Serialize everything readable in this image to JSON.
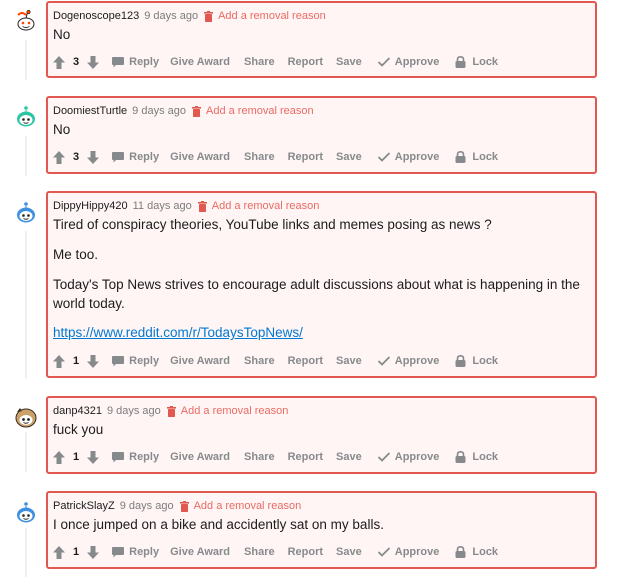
{
  "comments": [
    {
      "username": "Dogenoscope123",
      "time": "9 days ago",
      "removal_label": "Add a removal reason",
      "body": [
        "No"
      ],
      "link": "",
      "score": "3",
      "avatar": "avatar-red-snoo-icon",
      "actions": {
        "reply": "Reply",
        "give_award": "Give Award",
        "share": "Share",
        "report": "Report",
        "save": "Save",
        "approve": "Approve",
        "lock": "Lock"
      }
    },
    {
      "username": "DoomiestTurtle",
      "time": "9 days ago",
      "removal_label": "Add a removal reason",
      "body": [
        "No"
      ],
      "link": "",
      "score": "3",
      "avatar": "avatar-teal-snoo-icon",
      "actions": {
        "reply": "Reply",
        "give_award": "Give Award",
        "share": "Share",
        "report": "Report",
        "save": "Save",
        "approve": "Approve",
        "lock": "Lock"
      }
    },
    {
      "username": "DippyHippy420",
      "time": "11 days ago",
      "removal_label": "Add a removal reason",
      "body": [
        "Tired of conspiracy theories, YouTube links and memes posing as news ?",
        "Me too.",
        "Today's Top News strives to encourage adult discussions about what is happening in the world today."
      ],
      "link": "https://www.reddit.com/r/TodaysTopNews/",
      "score": "1",
      "avatar": "avatar-blue-snoo-icon",
      "actions": {
        "reply": "Reply",
        "give_award": "Give Award",
        "share": "Share",
        "report": "Report",
        "save": "Save",
        "approve": "Approve",
        "lock": "Lock"
      }
    },
    {
      "username": "danp4321",
      "time": "9 days ago",
      "removal_label": "Add a removal reason",
      "body": [
        "fuck you"
      ],
      "link": "",
      "score": "1",
      "avatar": "avatar-brown-snoo-icon",
      "actions": {
        "reply": "Reply",
        "give_award": "Give Award",
        "share": "Share",
        "report": "Report",
        "save": "Save",
        "approve": "Approve",
        "lock": "Lock"
      }
    },
    {
      "username": "PatrickSlayZ",
      "time": "9 days ago",
      "removal_label": "Add a removal reason",
      "body": [
        "I once jumped on a bike and accidently sat on my balls."
      ],
      "link": "",
      "score": "1",
      "avatar": "avatar-blue-snoo-icon",
      "actions": {
        "reply": "Reply",
        "give_award": "Give Award",
        "share": "Share",
        "report": "Report",
        "save": "Save",
        "approve": "Approve",
        "lock": "Lock"
      }
    }
  ],
  "colors": {
    "removed_border": "#e0584f",
    "removed_background": "#fff5f5",
    "removal_text": "#e96b63",
    "link": "#0079d3",
    "muted": "#878a8c"
  }
}
